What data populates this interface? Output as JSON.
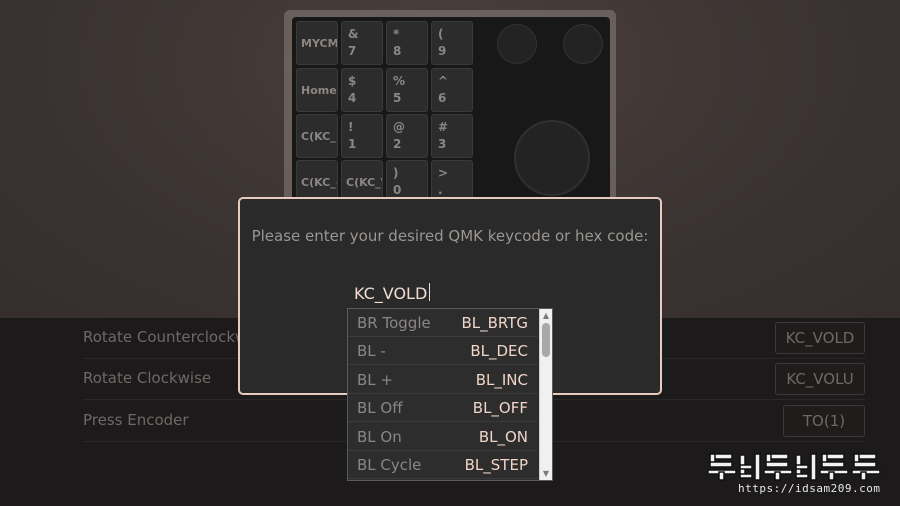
{
  "keyboard": {
    "keys": [
      {
        "text": "MYCM"
      },
      {
        "text": "&\n7"
      },
      {
        "text": "*\n8"
      },
      {
        "text": "(\n9"
      },
      {
        "text": "Home"
      },
      {
        "text": "$\n4"
      },
      {
        "text": "%\n5"
      },
      {
        "text": "^\n6"
      },
      {
        "text": "C(KC_)"
      },
      {
        "text": "!\n1"
      },
      {
        "text": "@\n2"
      },
      {
        "text": "#\n3"
      },
      {
        "text": "C(KC_("
      },
      {
        "text": "C(KC_\\"
      },
      {
        "text": ")\n0"
      },
      {
        "text": ">\n."
      }
    ]
  },
  "encoder_settings": {
    "rows": [
      {
        "label": "Rotate Counterclockwise",
        "value": "KC_VOLD"
      },
      {
        "label": "Rotate Clockwise",
        "value": "KC_VOLU"
      },
      {
        "label": "Press Encoder",
        "value": "TO(1)"
      }
    ]
  },
  "modal": {
    "prompt": "Please enter your desired QMK keycode or hex code:",
    "input_value": "KC_VOLD"
  },
  "dropdown": {
    "items": [
      {
        "label": "BR Toggle",
        "code": "BL_BRTG"
      },
      {
        "label": "BL -",
        "code": "BL_DEC"
      },
      {
        "label": "BL +",
        "code": "BL_INC"
      },
      {
        "label": "BL Off",
        "code": "BL_OFF"
      },
      {
        "label": "BL On",
        "code": "BL_ON"
      },
      {
        "label": "BL Cycle",
        "code": "BL_STEP"
      }
    ]
  },
  "watermark": {
    "logo_text": "뚜비뚜비뚜뚜바",
    "url": "https://idsam209.com"
  },
  "colors": {
    "accent": "#e6cbbf",
    "code_text": "#f0d5c9",
    "modal_bg": "#2a2a2a"
  }
}
